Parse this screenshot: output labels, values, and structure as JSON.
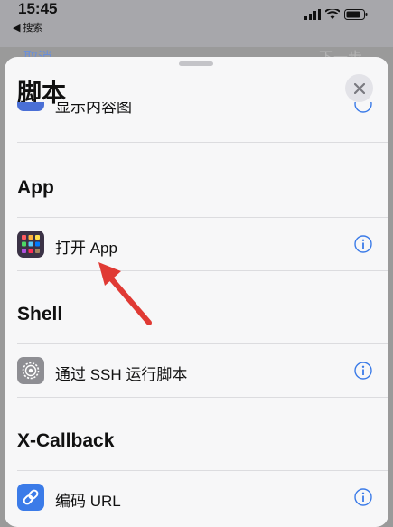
{
  "status_bar": {
    "time": "15:45",
    "back_label": "◀ 搜索"
  },
  "behind": {
    "left": "取消",
    "right": "下一步"
  },
  "sheet": {
    "title": "脚本",
    "partial_row_label": "显示内容图",
    "sections": [
      {
        "header": "App",
        "rows": [
          {
            "label": "打开 App",
            "icon": "app-grid-icon"
          }
        ]
      },
      {
        "header": "Shell",
        "rows": [
          {
            "label": "通过 SSH 运行脚本",
            "icon": "gear-icon"
          }
        ]
      },
      {
        "header": "X-Callback",
        "rows": [
          {
            "label": "编码 URL",
            "icon": "link-icon"
          }
        ]
      }
    ]
  },
  "colors": {
    "accent": "#3b7be8",
    "arrow": "#e03a34"
  }
}
